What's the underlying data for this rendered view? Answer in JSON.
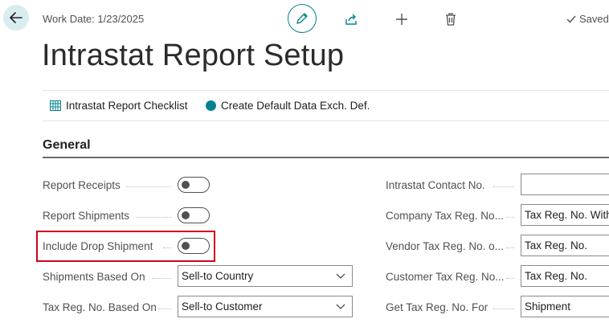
{
  "header": {
    "work_date": "Work Date: 1/23/2025",
    "saved": "Saved"
  },
  "page": {
    "title": "Intrastat Report Setup"
  },
  "actions": {
    "checklist": "Intrastat Report Checklist",
    "create_default": "Create Default Data Exch. Def."
  },
  "general": {
    "section_title": "General",
    "left_fields": {
      "report_receipts": {
        "label": "Report Receipts",
        "value": false
      },
      "report_shipments": {
        "label": "Report Shipments",
        "value": false
      },
      "include_drop_shipment": {
        "label": "Include Drop Shipment",
        "value": false
      },
      "shipments_based_on": {
        "label": "Shipments Based On",
        "value": "Sell-to Country"
      },
      "tax_reg_based_on": {
        "label": "Tax Reg. No. Based On",
        "value": "Sell-to Customer"
      }
    },
    "right_fields": {
      "intrastat_contact_no": {
        "label": "Intrastat Contact No.",
        "value": ""
      },
      "company_tax_reg": {
        "label": "Company Tax Reg. No...",
        "value": "Tax Reg. No. With"
      },
      "vendor_tax_reg": {
        "label": "Vendor Tax Reg. No. o...",
        "value": "Tax Reg. No."
      },
      "customer_tax_reg": {
        "label": "Customer Tax Reg. No...",
        "value": "Tax Reg. No."
      },
      "get_tax_reg_for": {
        "label": "Get Tax Reg. No. For",
        "value": "Shipment"
      }
    }
  },
  "colors": {
    "accent": "#00838f",
    "highlight": "#d0021b"
  },
  "icons": [
    "back-arrow-icon",
    "pencil-icon",
    "share-icon",
    "plus-icon",
    "trash-icon",
    "check-icon",
    "checklist-icon",
    "circle-icon",
    "chevron-down-icon"
  ]
}
